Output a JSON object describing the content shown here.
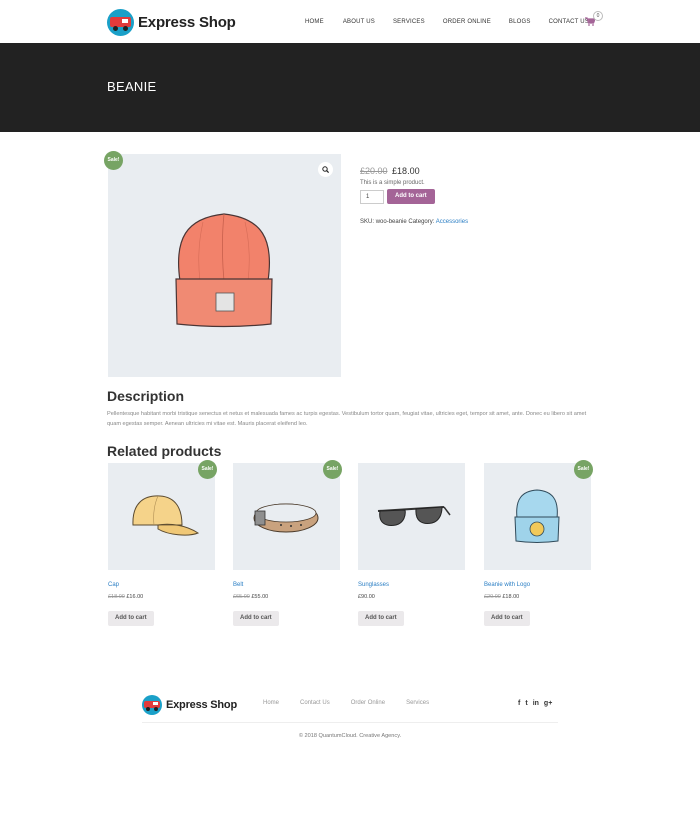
{
  "header": {
    "brand": "Express Shop",
    "nav": [
      "HOME",
      "ABOUT US",
      "SERVICES",
      "ORDER ONLINE",
      "BLOGS",
      "CONTACT US"
    ],
    "cart_count": "0"
  },
  "page": {
    "title": "BEANIE"
  },
  "product": {
    "sale_badge": "Sale!",
    "old_price": "£20.00",
    "price": "£18.00",
    "short_description": "This is a simple product.",
    "quantity": "1",
    "add_to_cart": "Add to cart",
    "sku_label": "SKU:",
    "sku": "woo-beanie",
    "category_label": "Category:",
    "category": "Accessories"
  },
  "description": {
    "heading": "Description",
    "text": "Pellentesque habitant morbi tristique senectus et netus et malesuada fames ac turpis egestas. Vestibulum tortor quam, feugiat vitae, ultricies eget, tempor sit amet, ante. Donec eu libero sit amet quam egestas semper. Aenean ultricies mi vitae est. Mauris placerat eleifend leo."
  },
  "related": {
    "heading": "Related products",
    "items": [
      {
        "name": "Cap",
        "old_price": "£18.00",
        "price": "£16.00",
        "sale": "Sale!",
        "button": "Add to cart"
      },
      {
        "name": "Belt",
        "old_price": "£65.00",
        "price": "£55.00",
        "sale": "Sale!",
        "button": "Add to cart"
      },
      {
        "name": "Sunglasses",
        "old_price": "",
        "price": "£90.00",
        "sale": "",
        "button": "Add to cart"
      },
      {
        "name": "Beanie with Logo",
        "old_price": "£20.00",
        "price": "£18.00",
        "sale": "Sale!",
        "button": "Add to cart"
      }
    ]
  },
  "footer": {
    "brand": "Express Shop",
    "links": [
      "Home",
      "Contact Us",
      "Order Online",
      "Services"
    ],
    "social": [
      "f",
      "t",
      "in",
      "g+"
    ],
    "copyright": "© 2018 QuantumCloud. Creative Agency."
  },
  "colors": {
    "sale_green": "#77a464",
    "button_purple": "#a46497",
    "link_blue": "#2a7ec4",
    "title_band": "#222222"
  }
}
